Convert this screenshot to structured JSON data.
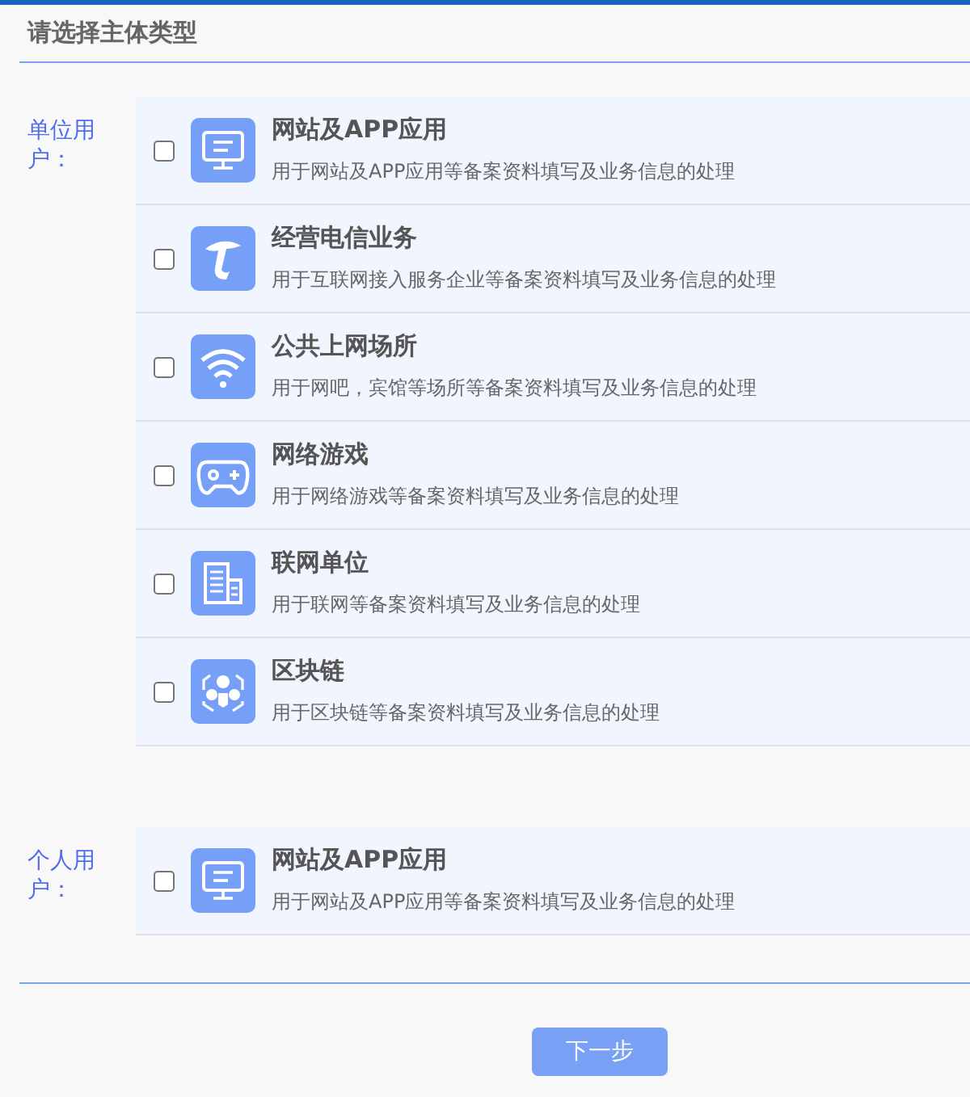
{
  "title": "请选择主体类型",
  "groups": [
    {
      "label": "单位用户：",
      "items": [
        {
          "kind": "website",
          "title": "网站及APP应用",
          "desc": "用于网站及APP应用等备案资料填写及业务信息的处理",
          "checked": false
        },
        {
          "kind": "telecom",
          "title": "经营电信业务",
          "desc": "用于互联网接入服务企业等备案资料填写及业务信息的处理",
          "checked": false
        },
        {
          "kind": "wifi",
          "title": "公共上网场所",
          "desc": "用于网吧，宾馆等场所等备案资料填写及业务信息的处理",
          "checked": false
        },
        {
          "kind": "game",
          "title": "网络游戏",
          "desc": "用于网络游戏等备案资料填写及业务信息的处理",
          "checked": false
        },
        {
          "kind": "building",
          "title": "联网单位",
          "desc": "用于联网等备案资料填写及业务信息的处理",
          "checked": false
        },
        {
          "kind": "blockchain",
          "title": "区块链",
          "desc": "用于区块链等备案资料填写及业务信息的处理",
          "checked": false
        }
      ]
    },
    {
      "label": "个人用户：",
      "items": [
        {
          "kind": "website",
          "title": "网站及APP应用",
          "desc": "用于网站及APP应用等备案资料填写及业务信息的处理",
          "checked": false
        }
      ]
    }
  ],
  "button": "下一步"
}
